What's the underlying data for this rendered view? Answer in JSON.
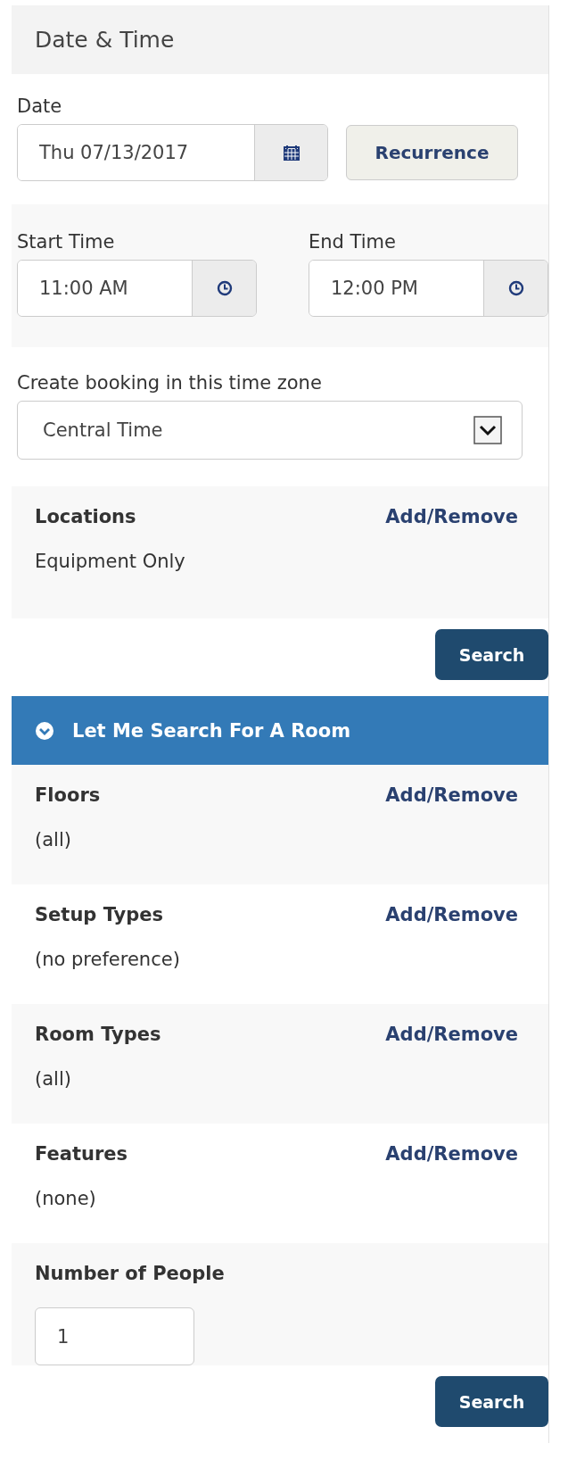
{
  "header": {
    "title": "Date & Time"
  },
  "date": {
    "label": "Date",
    "value": "Thu 07/13/2017"
  },
  "recurrence_button": "Recurrence",
  "times": [
    {
      "label": "Start Time",
      "value": "11:00 AM"
    },
    {
      "label": "End Time",
      "value": "12:00 PM"
    }
  ],
  "time_zone": {
    "label": "Create booking in this time zone",
    "value": "Central Time"
  },
  "locations": {
    "label": "Locations",
    "link": "Add/Remove",
    "value": "Equipment Only"
  },
  "search_button_1": "Search",
  "room_search": {
    "title": "Let Me Search For A Room",
    "expanded": true,
    "sections": [
      {
        "kind": "filter",
        "label": "Floors",
        "link": "Add/Remove",
        "value": "(all)"
      },
      {
        "kind": "filter",
        "label": "Setup Types",
        "link": "Add/Remove",
        "value": "(no preference)"
      },
      {
        "kind": "filter",
        "label": "Room Types",
        "link": "Add/Remove",
        "value": "(all)"
      },
      {
        "kind": "filter",
        "label": "Features",
        "link": "Add/Remove",
        "value": "(none)"
      },
      {
        "kind": "number",
        "label": "Number of People",
        "value": "1"
      }
    ]
  },
  "search_button_2": "Search"
}
